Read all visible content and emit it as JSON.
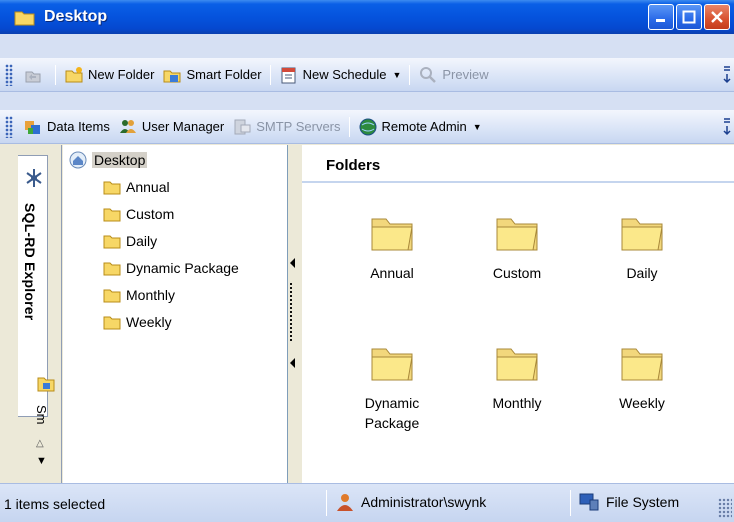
{
  "window": {
    "title": "Desktop",
    "title_icon": "folder-icon"
  },
  "toolbar1": {
    "items": [
      {
        "label": "",
        "icon": "back-icon",
        "disabled": true
      },
      {
        "label": "New Folder",
        "icon": "new-folder-icon"
      },
      {
        "label": "Smart Folder",
        "icon": "smart-folder-icon"
      },
      {
        "label": "New Schedule",
        "icon": "schedule-icon",
        "dropdown": true
      },
      {
        "label": "Preview",
        "icon": "preview-icon",
        "disabled": true
      }
    ]
  },
  "toolbar2": {
    "items": [
      {
        "label": "Data Items",
        "icon": "data-items-icon"
      },
      {
        "label": "User Manager",
        "icon": "users-icon"
      },
      {
        "label": "SMTP Servers",
        "icon": "smtp-icon",
        "disabled": true
      },
      {
        "label": "Remote Admin",
        "icon": "globe-icon",
        "dropdown": true
      }
    ]
  },
  "sidebar": {
    "tab_explorer": "SQL-RD Explorer",
    "tab_small": "Sm"
  },
  "tree": {
    "root": "Desktop",
    "children": [
      "Annual",
      "Custom",
      "Daily",
      "Dynamic Package",
      "Monthly",
      "Weekly"
    ]
  },
  "content": {
    "title": "Folders",
    "folders": [
      "Annual",
      "Custom",
      "Daily",
      "Dynamic Package",
      "Monthly",
      "Weekly"
    ],
    "folder_line1": [
      "Annual",
      "Custom",
      "Daily",
      "Dynamic",
      "Monthly",
      "Weekly"
    ],
    "folder_line2": [
      "",
      "",
      "",
      "Package",
      "",
      ""
    ]
  },
  "statusbar": {
    "selection": "1 items selected",
    "user": "Administrator\\swynk",
    "source": "File System"
  },
  "colors": {
    "titlebar": "#0553dd",
    "toolbar": "#dbe5f7",
    "folder_fill": "#fbe88a"
  }
}
